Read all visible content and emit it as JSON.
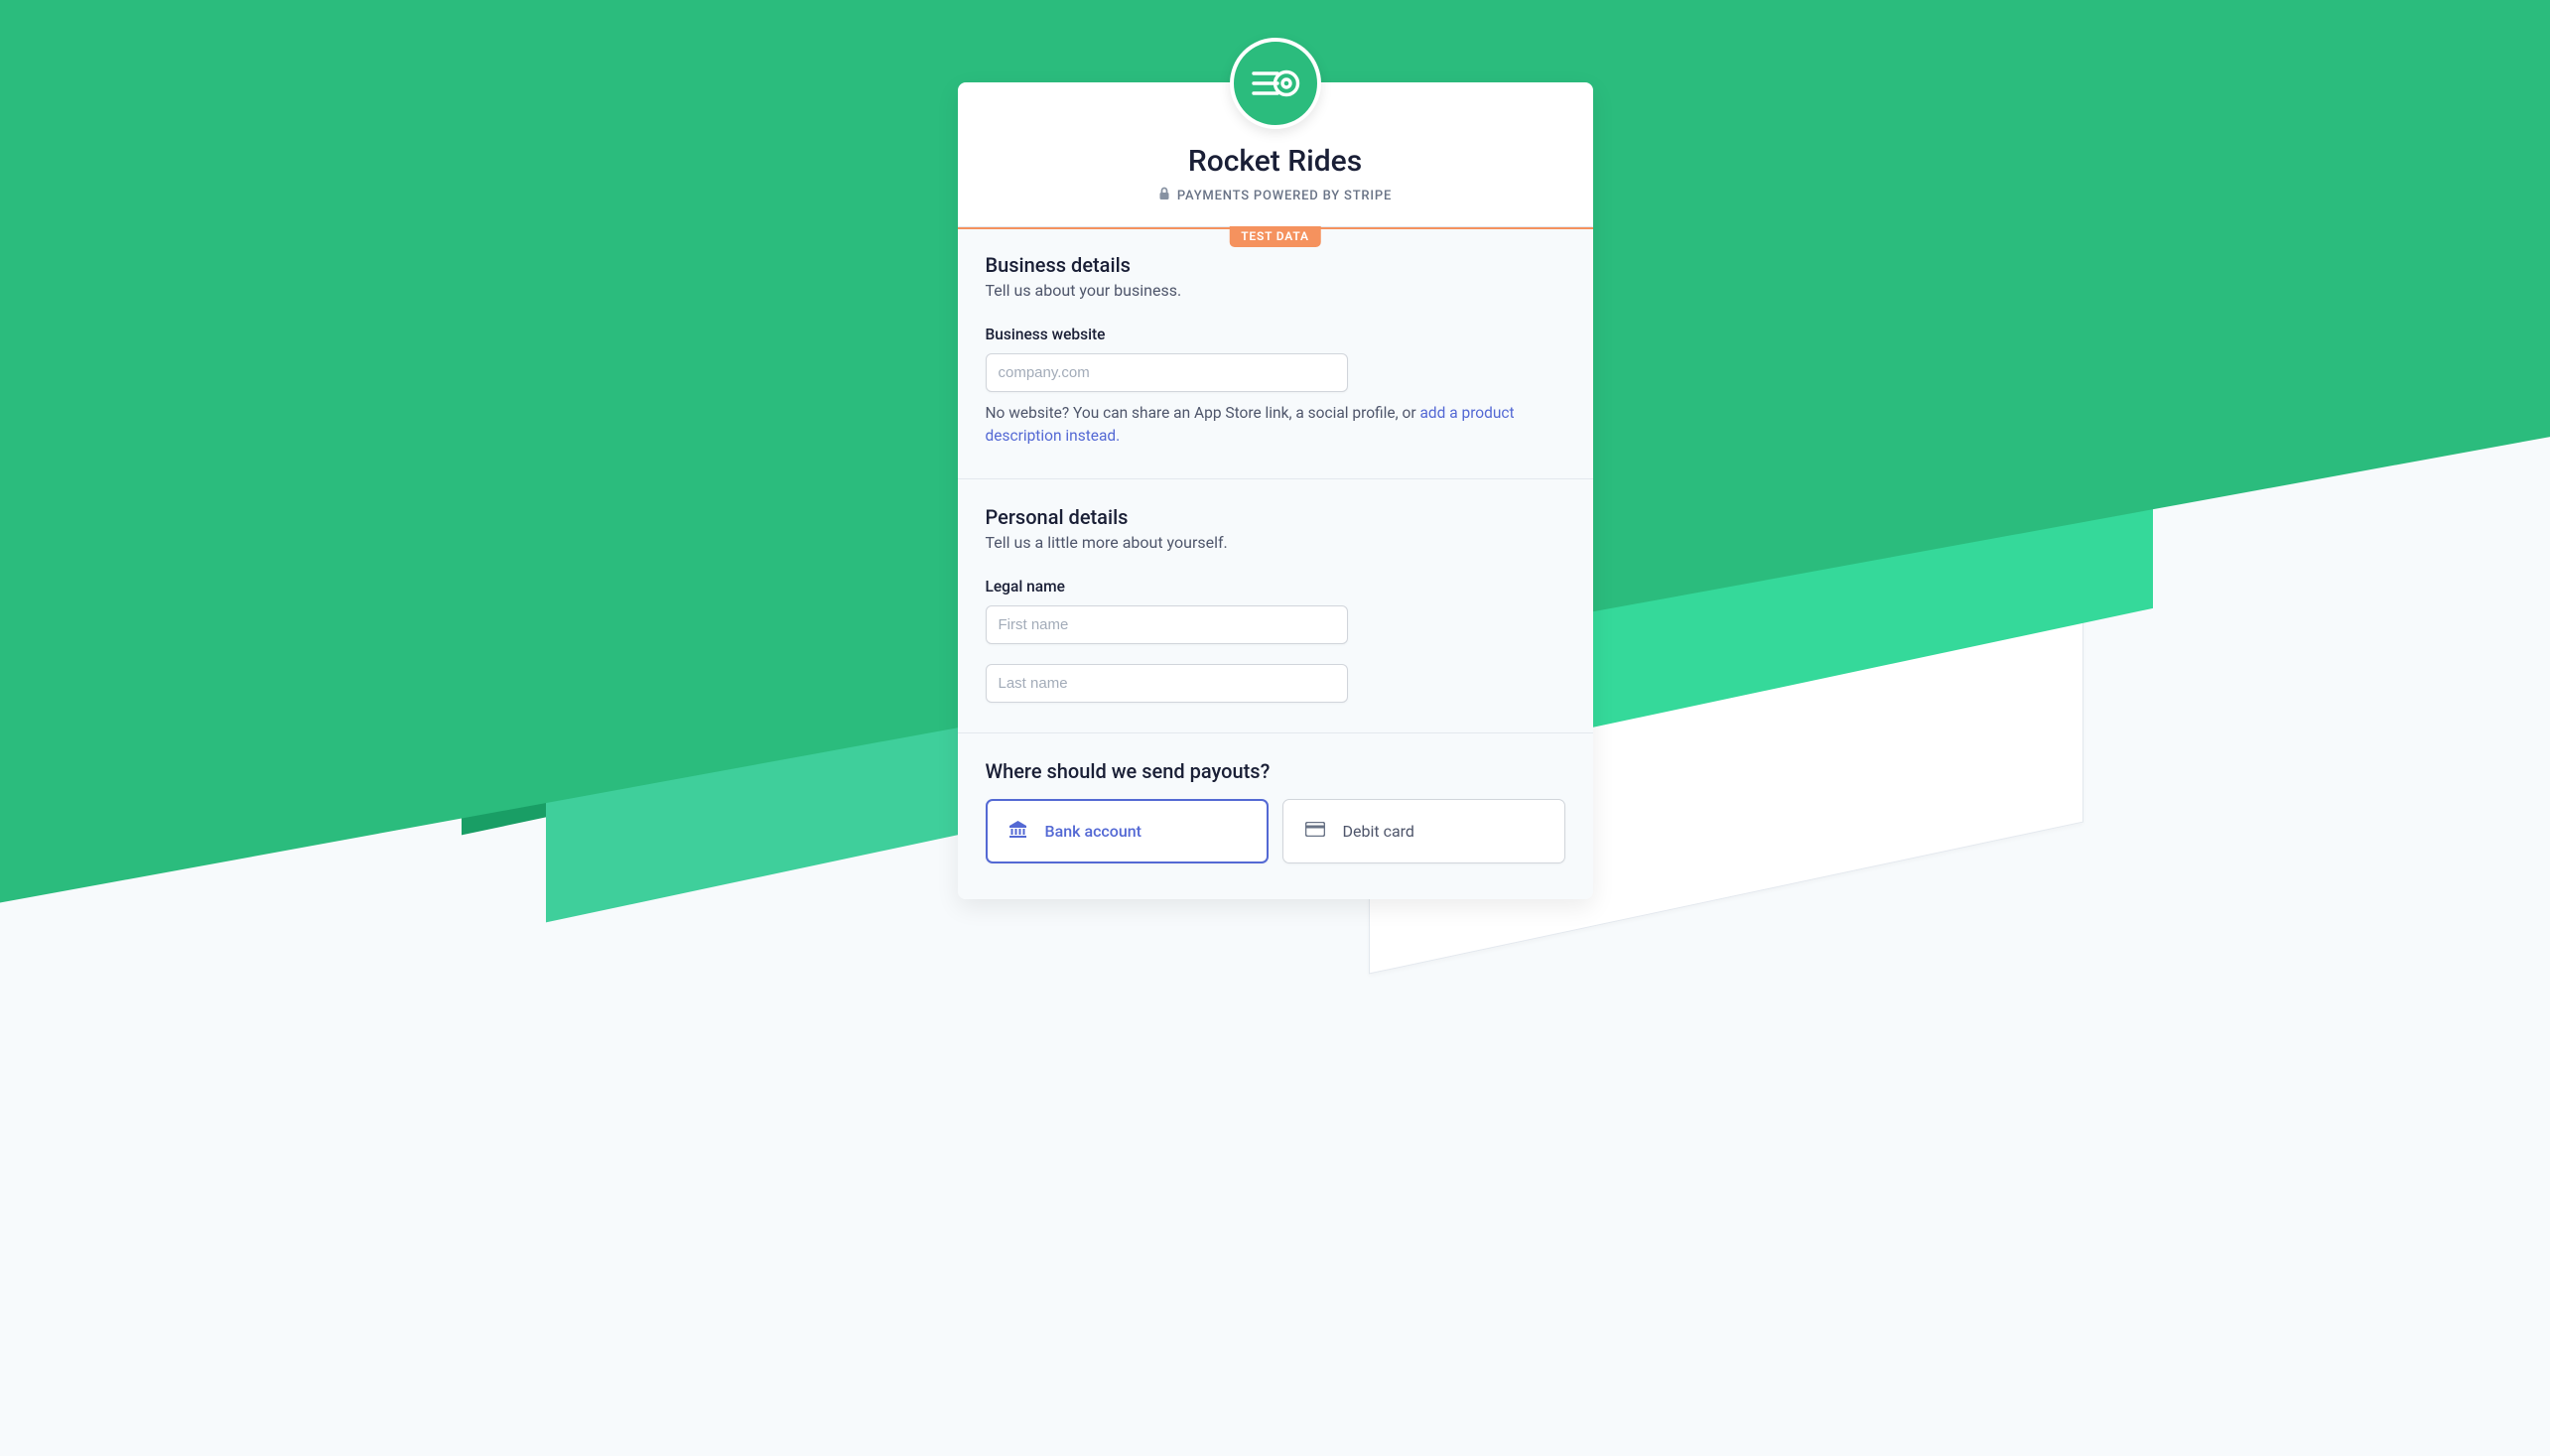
{
  "brand": {
    "name": "Rocket Rides",
    "powered_by": "PAYMENTS POWERED BY STRIPE"
  },
  "test_badge": "TEST DATA",
  "sections": {
    "business": {
      "title": "Business details",
      "subtitle": "Tell us about your business.",
      "website_label": "Business website",
      "website_placeholder": "company.com",
      "helper_text_prefix": "No website? You can share an App Store link, a social profile, or ",
      "helper_link": "add a product description instead."
    },
    "personal": {
      "title": "Personal details",
      "subtitle": "Tell us a little more about yourself.",
      "legal_name_label": "Legal name",
      "first_name_placeholder": "First name",
      "last_name_placeholder": "Last name"
    },
    "payouts": {
      "title": "Where should we send payouts?",
      "options": {
        "bank": "Bank account",
        "debit": "Debit card"
      }
    }
  }
}
